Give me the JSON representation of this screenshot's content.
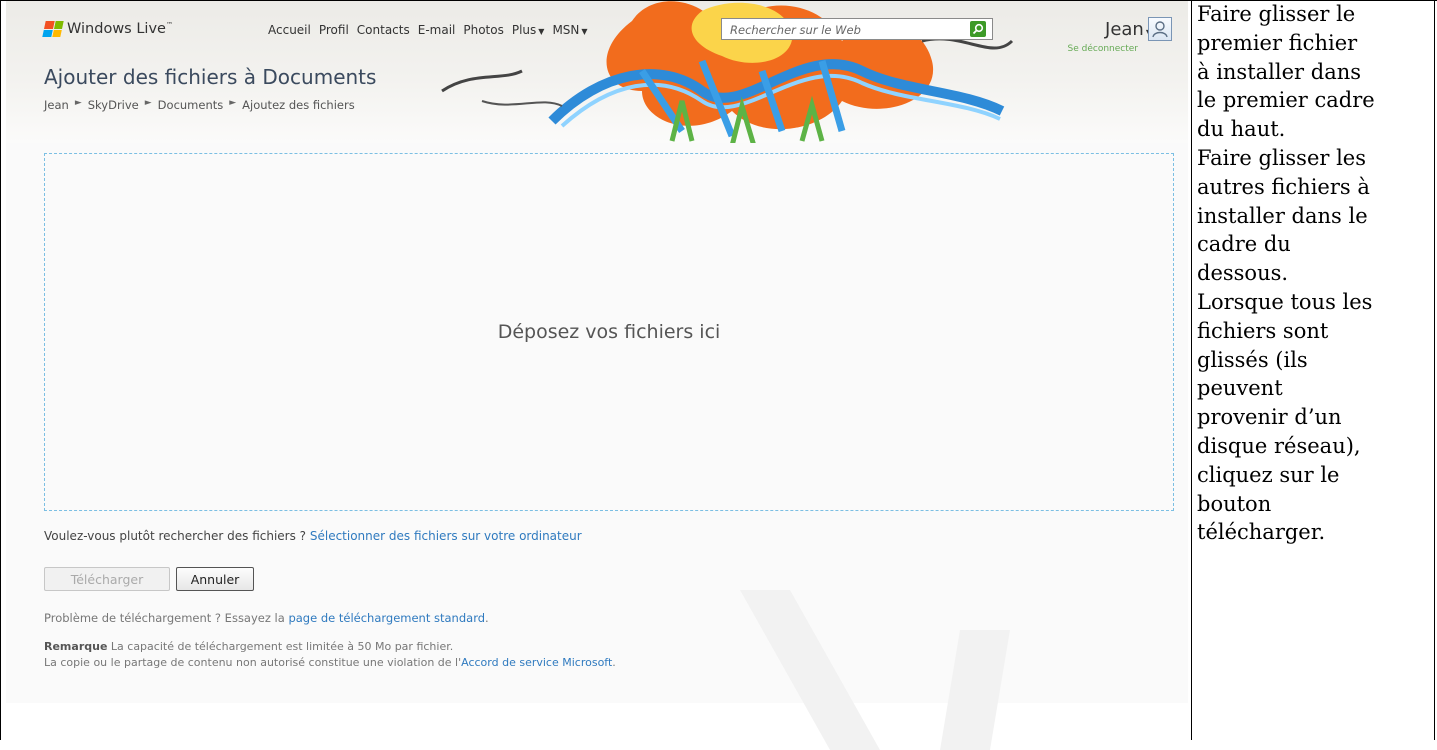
{
  "header": {
    "brand": "Windows Live",
    "brand_mark": "™",
    "nav": [
      {
        "label": "Accueil",
        "caret": ""
      },
      {
        "label": "Profil",
        "caret": ""
      },
      {
        "label": "Contacts",
        "caret": ""
      },
      {
        "label": "E-mail",
        "caret": ""
      },
      {
        "label": "Photos",
        "caret": ""
      },
      {
        "label": "Plus",
        "caret": "▼"
      },
      {
        "label": "MSN",
        "caret": "▼"
      }
    ],
    "search_placeholder": "Rechercher sur le Web",
    "user_name": "Jean",
    "user_caret": "▼",
    "signout": "Se déconnecter"
  },
  "page": {
    "title": "Ajouter des fichiers à Documents",
    "breadcrumb": [
      "Jean",
      "SkyDrive",
      "Documents",
      "Ajoutez des fichiers"
    ],
    "breadcrumb_sep": "►"
  },
  "dropzone": {
    "label": "Déposez vos fichiers ici"
  },
  "browse": {
    "prompt": "Voulez-vous plutôt rechercher des fichiers ? ",
    "link": "Sélectionner des fichiers sur votre ordinateur"
  },
  "buttons": {
    "upload": "Télécharger",
    "cancel": "Annuler"
  },
  "help": {
    "problem_prefix": "Problème de téléchargement ? Essayez la ",
    "problem_link": "page de téléchargement standard",
    "problem_suffix": ".",
    "note_label": "Remarque",
    "note_text": "  La capacité de téléchargement est limitée à 50 Mo par fichier.",
    "legal_prefix": "La copie ou le partage de contenu non autorisé constitue une violation de l'",
    "legal_link": "Accord de service Microsoft",
    "legal_suffix": "."
  },
  "instructions": [
    "Faire glisser le",
    "premier fichier",
    "à installer dans",
    "le premier cadre",
    "du haut.",
    "Faire glisser les",
    "autres fichiers à",
    "installer dans le",
    "cadre du",
    "dessous.",
    "Lorsque tous les",
    "fichiers sont",
    "glissés (ils",
    "peuvent",
    "provenir d’un",
    "disque réseau),",
    "cliquez sur le",
    "bouton",
    "télécharger."
  ],
  "colors": {
    "link": "#2f7abf",
    "title": "#3b4a5e",
    "dropzone_border": "#7bbfe3",
    "search_button": "#3d9a27"
  },
  "icons": [
    "windows-flag-icon",
    "search-icon",
    "user-icon",
    "graffiti-banner"
  ]
}
